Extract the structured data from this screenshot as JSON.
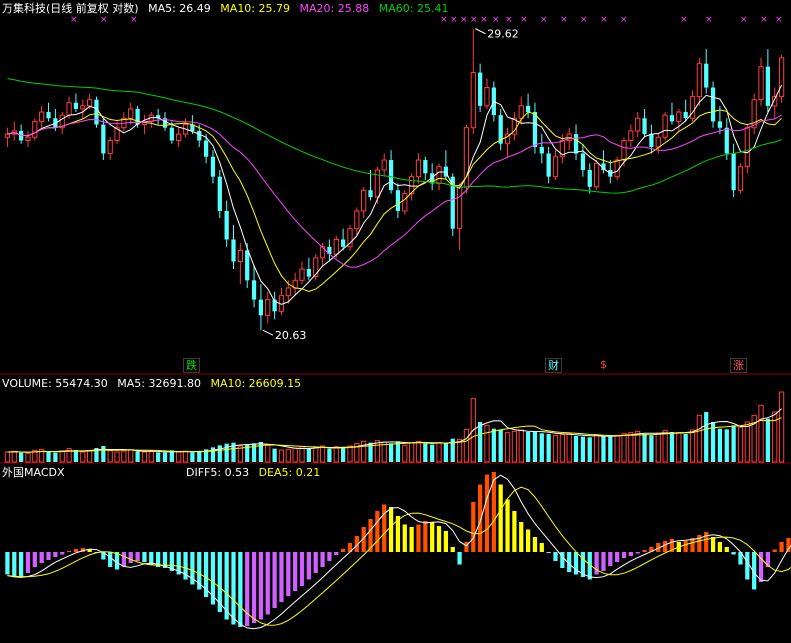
{
  "colors": {
    "background": "#000000",
    "up": "#ff3c3c",
    "down": "#54ffff",
    "ma5": "#ffffff",
    "ma10": "#ffff00",
    "ma20": "#ff44ff",
    "ma60": "#00d000",
    "grid": "#880000",
    "hist_up_a": "#ff5000",
    "hist_up_b": "#ffff00",
    "hist_dn_a": "#54ffff",
    "hist_dn_b": "#d060ff"
  },
  "header": {
    "title": "万集科技(日线 前复权 对数)",
    "ma5": "MA5: 26.49",
    "ma10": "MA10: 25.79",
    "ma20": "MA20: 25.88",
    "ma60": "MA60: 25.41"
  },
  "volume_header": {
    "volume": "VOLUME: 55474.30",
    "ma5": "MA5: 32691.80",
    "ma10": "MA10: 26609.15"
  },
  "macd_header": {
    "name": "外国MACDX",
    "diff": "DIFF5: 0.53",
    "dea": "DEA5: 0.21"
  },
  "annotations": {
    "high_label": "29.62",
    "low_label": "20.63",
    "fall_tag": "跌",
    "finance_tag": "财",
    "dollar_tag": "$",
    "rise_tag": "涨",
    "marker_glyph": "×"
  },
  "chart_data": [
    {
      "type": "candlestick",
      "price_range": [
        20.0,
        30.0
      ],
      "high": 29.62,
      "low": 20.63,
      "candles": [
        [
          26.0,
          26.3,
          25.7,
          26.1
        ],
        [
          26.1,
          26.5,
          25.9,
          26.2
        ],
        [
          26.2,
          26.4,
          25.8,
          25.9
        ],
        [
          25.9,
          26.2,
          25.7,
          26.0
        ],
        [
          26.0,
          26.6,
          25.9,
          26.5
        ],
        [
          26.5,
          27.0,
          26.3,
          26.8
        ],
        [
          26.8,
          27.1,
          26.5,
          26.6
        ],
        [
          26.6,
          26.9,
          26.2,
          26.3
        ],
        [
          26.3,
          26.8,
          26.1,
          26.7
        ],
        [
          26.7,
          27.3,
          26.6,
          27.1
        ],
        [
          27.1,
          27.4,
          26.8,
          26.9
        ],
        [
          26.9,
          27.2,
          26.6,
          27.0
        ],
        [
          27.0,
          27.4,
          26.9,
          27.2
        ],
        [
          27.2,
          27.3,
          26.3,
          26.4
        ],
        [
          26.4,
          26.6,
          25.3,
          25.5
        ],
        [
          25.5,
          26.0,
          25.3,
          25.9
        ],
        [
          25.9,
          26.5,
          25.8,
          26.3
        ],
        [
          26.3,
          26.8,
          26.2,
          26.6
        ],
        [
          26.6,
          27.1,
          26.4,
          26.9
        ],
        [
          26.9,
          27.0,
          26.3,
          26.4
        ],
        [
          26.4,
          26.7,
          26.1,
          26.5
        ],
        [
          26.5,
          26.8,
          26.3,
          26.7
        ],
        [
          26.7,
          26.9,
          26.4,
          26.6
        ],
        [
          26.6,
          26.8,
          26.2,
          26.3
        ],
        [
          26.3,
          26.5,
          25.8,
          25.9
        ],
        [
          25.9,
          26.3,
          25.7,
          26.1
        ],
        [
          26.1,
          26.6,
          26.0,
          26.4
        ],
        [
          26.4,
          26.7,
          26.1,
          26.2
        ],
        [
          26.2,
          26.4,
          25.7,
          25.9
        ],
        [
          25.9,
          26.1,
          25.2,
          25.4
        ],
        [
          25.4,
          25.6,
          24.6,
          24.8
        ],
        [
          24.8,
          25.0,
          23.6,
          23.8
        ],
        [
          23.8,
          24.1,
          22.8,
          23.0
        ],
        [
          23.0,
          23.4,
          22.2,
          22.4
        ],
        [
          22.4,
          22.9,
          21.8,
          22.7
        ],
        [
          22.7,
          22.9,
          21.7,
          21.9
        ],
        [
          21.9,
          22.3,
          21.2,
          21.4
        ],
        [
          21.4,
          21.8,
          20.63,
          21.0
        ],
        [
          21.0,
          21.6,
          20.8,
          21.4
        ],
        [
          21.4,
          21.6,
          20.9,
          21.1
        ],
        [
          21.1,
          21.7,
          21.0,
          21.5
        ],
        [
          21.5,
          21.9,
          21.3,
          21.7
        ],
        [
          21.7,
          22.1,
          21.5,
          21.9
        ],
        [
          21.9,
          22.4,
          21.8,
          22.2
        ],
        [
          22.2,
          22.5,
          21.9,
          22.0
        ],
        [
          22.0,
          22.6,
          21.9,
          22.5
        ],
        [
          22.5,
          22.9,
          22.3,
          22.8
        ],
        [
          22.8,
          23.0,
          22.4,
          22.6
        ],
        [
          22.6,
          23.1,
          22.5,
          23.0
        ],
        [
          23.0,
          23.3,
          22.7,
          22.8
        ],
        [
          22.8,
          23.4,
          22.7,
          23.3
        ],
        [
          23.3,
          23.9,
          23.1,
          23.8
        ],
        [
          23.8,
          24.5,
          23.6,
          24.4
        ],
        [
          24.4,
          25.0,
          24.1,
          24.2
        ],
        [
          24.2,
          25.1,
          24.0,
          25.0
        ],
        [
          25.0,
          25.5,
          24.8,
          25.3
        ],
        [
          25.3,
          25.6,
          24.3,
          24.4
        ],
        [
          24.4,
          24.6,
          23.6,
          23.8
        ],
        [
          23.8,
          24.4,
          23.7,
          24.3
        ],
        [
          24.3,
          24.9,
          24.1,
          24.8
        ],
        [
          24.8,
          25.5,
          24.6,
          25.3
        ],
        [
          25.3,
          25.4,
          24.7,
          24.9
        ],
        [
          24.9,
          25.2,
          24.4,
          24.6
        ],
        [
          24.6,
          25.2,
          24.4,
          25.1
        ],
        [
          25.1,
          25.6,
          24.7,
          24.8
        ],
        [
          24.8,
          24.9,
          23.1,
          23.3
        ],
        [
          23.3,
          24.6,
          22.7,
          24.5
        ],
        [
          24.5,
          26.4,
          24.3,
          26.3
        ],
        [
          26.3,
          29.62,
          26.1,
          28.1
        ],
        [
          28.1,
          28.4,
          26.8,
          27.0
        ],
        [
          27.0,
          27.9,
          26.9,
          27.6
        ],
        [
          27.6,
          27.8,
          26.5,
          26.7
        ],
        [
          26.7,
          26.9,
          25.6,
          25.8
        ],
        [
          25.8,
          26.3,
          25.4,
          26.1
        ],
        [
          26.1,
          26.8,
          25.9,
          26.6
        ],
        [
          26.6,
          27.3,
          26.4,
          27.0
        ],
        [
          27.0,
          27.4,
          26.6,
          26.8
        ],
        [
          26.8,
          27.1,
          25.5,
          25.7
        ],
        [
          25.7,
          26.1,
          25.2,
          25.5
        ],
        [
          25.5,
          25.7,
          24.6,
          24.8
        ],
        [
          24.8,
          25.6,
          24.7,
          25.4
        ],
        [
          25.4,
          26.1,
          25.2,
          25.9
        ],
        [
          25.9,
          26.3,
          25.6,
          26.1
        ],
        [
          26.1,
          26.4,
          25.3,
          25.5
        ],
        [
          25.5,
          25.8,
          24.8,
          25.0
        ],
        [
          25.0,
          25.2,
          24.3,
          24.5
        ],
        [
          24.5,
          25.3,
          24.4,
          25.2
        ],
        [
          25.2,
          25.6,
          24.9,
          25.0
        ],
        [
          25.0,
          25.3,
          24.6,
          24.8
        ],
        [
          24.8,
          25.4,
          24.7,
          25.3
        ],
        [
          25.3,
          26.0,
          25.1,
          25.9
        ],
        [
          25.9,
          26.4,
          25.7,
          26.2
        ],
        [
          26.2,
          26.8,
          26.0,
          26.6
        ],
        [
          26.6,
          26.9,
          26.0,
          26.1
        ],
        [
          26.1,
          26.4,
          25.5,
          25.7
        ],
        [
          25.7,
          26.1,
          25.5,
          26.0
        ],
        [
          26.0,
          26.8,
          25.9,
          26.7
        ],
        [
          26.7,
          27.1,
          26.4,
          26.5
        ],
        [
          26.5,
          26.9,
          26.2,
          26.8
        ],
        [
          26.8,
          27.2,
          26.5,
          26.6
        ],
        [
          26.6,
          27.5,
          26.5,
          27.3
        ],
        [
          27.3,
          28.6,
          27.0,
          28.4
        ],
        [
          28.4,
          28.9,
          27.4,
          27.6
        ],
        [
          27.6,
          27.8,
          26.3,
          26.5
        ],
        [
          26.5,
          27.0,
          26.1,
          26.3
        ],
        [
          26.3,
          26.6,
          25.3,
          25.5
        ],
        [
          25.5,
          25.8,
          24.2,
          24.4
        ],
        [
          24.4,
          25.2,
          24.3,
          25.1
        ],
        [
          25.1,
          26.4,
          24.9,
          26.3
        ],
        [
          26.3,
          27.4,
          26.1,
          27.2
        ],
        [
          27.2,
          28.6,
          27.0,
          28.3
        ],
        [
          28.3,
          28.9,
          26.8,
          27.0
        ],
        [
          27.0,
          27.6,
          26.6,
          27.3
        ],
        [
          27.3,
          28.7,
          27.1,
          28.6
        ]
      ]
    },
    {
      "type": "bar",
      "name": "VOLUME",
      "values": [
        30,
        32,
        28,
        26,
        35,
        38,
        30,
        28,
        33,
        40,
        36,
        30,
        34,
        42,
        48,
        34,
        30,
        33,
        37,
        32,
        30,
        31,
        29,
        28,
        35,
        30,
        32,
        29,
        33,
        38,
        44,
        50,
        55,
        58,
        48,
        52,
        56,
        60,
        50,
        40,
        36,
        38,
        42,
        46,
        40,
        44,
        48,
        40,
        46,
        42,
        48,
        55,
        62,
        58,
        64,
        60,
        56,
        62,
        50,
        58,
        62,
        56,
        52,
        58,
        56,
        70,
        68,
        98,
        190,
        120,
        110,
        100,
        96,
        88,
        92,
        96,
        90,
        92,
        86,
        84,
        80,
        82,
        84,
        78,
        76,
        74,
        82,
        78,
        76,
        80,
        86,
        88,
        92,
        84,
        80,
        86,
        94,
        90,
        88,
        84,
        96,
        140,
        150,
        120,
        100,
        98,
        110,
        104,
        120,
        140,
        170,
        130,
        150,
        210
      ]
    },
    {
      "type": "bar",
      "name": "MACDX",
      "values": [
        -0.45,
        -0.5,
        -0.5,
        -0.42,
        -0.3,
        -0.22,
        -0.16,
        -0.1,
        -0.05,
        0.02,
        0.06,
        0.08,
        0.06,
        -0.02,
        -0.15,
        -0.3,
        -0.35,
        -0.3,
        -0.22,
        -0.18,
        -0.2,
        -0.26,
        -0.3,
        -0.32,
        -0.38,
        -0.45,
        -0.55,
        -0.65,
        -0.75,
        -0.9,
        -1.05,
        -1.2,
        -1.35,
        -1.45,
        -1.5,
        -1.48,
        -1.42,
        -1.35,
        -1.25,
        -1.12,
        -1.0,
        -0.88,
        -0.78,
        -0.68,
        -0.55,
        -0.42,
        -0.3,
        -0.18,
        -0.06,
        0.06,
        0.18,
        0.32,
        0.5,
        0.66,
        0.82,
        0.95,
        0.9,
        0.72,
        0.55,
        0.5,
        0.55,
        0.62,
        0.6,
        0.52,
        0.42,
        0.1,
        -0.25,
        0.2,
        1.0,
        1.35,
        1.55,
        1.6,
        1.35,
        1.05,
        0.82,
        0.6,
        0.45,
        0.3,
        0.18,
        -0.02,
        -0.18,
        -0.32,
        -0.4,
        -0.45,
        -0.5,
        -0.55,
        -0.45,
        -0.38,
        -0.28,
        -0.2,
        -0.12,
        -0.08,
        -0.03,
        0.04,
        0.1,
        0.18,
        0.22,
        0.26,
        0.2,
        0.22,
        0.28,
        0.34,
        0.4,
        0.3,
        0.2,
        0.1,
        -0.05,
        -0.25,
        -0.55,
        -0.75,
        -0.6,
        -0.3,
        0.05,
        0.2,
        0.28,
        0.35,
        0.45,
        0.6
      ]
    }
  ]
}
